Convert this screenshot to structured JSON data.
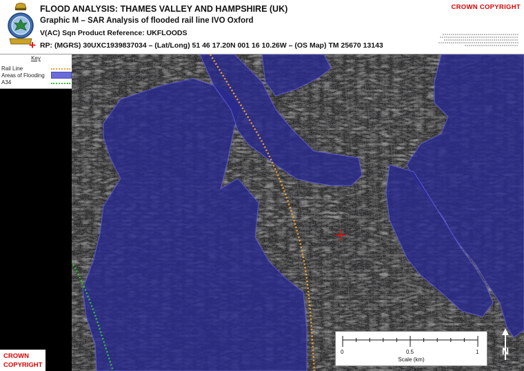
{
  "header": {
    "title": "FLOOD ANALYSIS: THAMES VALLEY AND HAMPSHIRE (UK)",
    "graphic": "Graphic M – SAR Analysis of flooded rail line IVO Oxford",
    "reference": "V(AC) Sqn Product Reference: UKFLOODS",
    "rp": "RP: (MGRS) 30UXC1939837034 – (Lat/Long) 51 46 17.20N 001 16 10.26W – (OS Map) TM 25670 13143",
    "crown_copyright": "CROWN COPYRIGHT"
  },
  "key": {
    "title": "Key",
    "items": [
      {
        "label": "Rail Line",
        "color": "#f0a030"
      },
      {
        "label": "Areas of Flooding",
        "color": "#6a6cd8"
      },
      {
        "label": "A34",
        "color": "#30c030"
      }
    ]
  },
  "scale": {
    "title": "Scale (km)",
    "ticks": [
      "0",
      "0.5",
      "1"
    ]
  },
  "north": "N",
  "footer": {
    "crown_line1": "CROWN",
    "crown_line2": "COPYRIGHT"
  },
  "colors": {
    "flood": "#2a2a8f",
    "rail": "#f0a030",
    "a34": "#30c030",
    "reference_point": "#d11"
  }
}
